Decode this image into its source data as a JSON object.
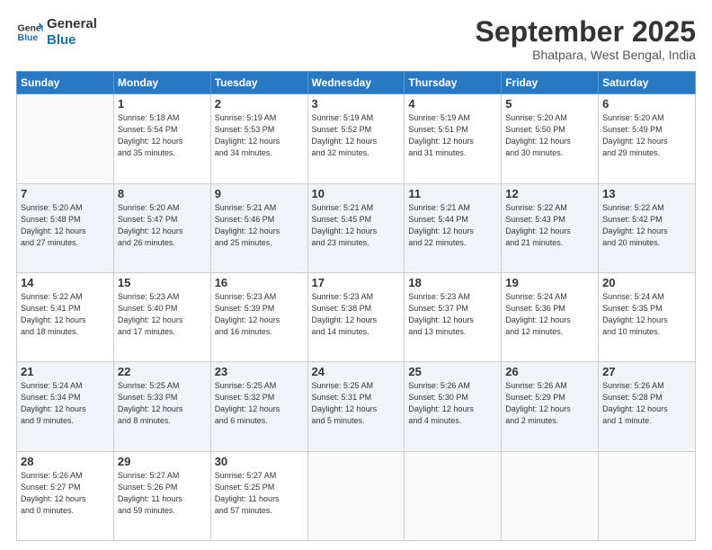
{
  "header": {
    "logo_line1": "General",
    "logo_line2": "Blue",
    "month": "September 2025",
    "location": "Bhatpara, West Bengal, India"
  },
  "days_of_week": [
    "Sunday",
    "Monday",
    "Tuesday",
    "Wednesday",
    "Thursday",
    "Friday",
    "Saturday"
  ],
  "weeks": [
    [
      {
        "day": "",
        "info": ""
      },
      {
        "day": "1",
        "info": "Sunrise: 5:18 AM\nSunset: 5:54 PM\nDaylight: 12 hours\nand 35 minutes."
      },
      {
        "day": "2",
        "info": "Sunrise: 5:19 AM\nSunset: 5:53 PM\nDaylight: 12 hours\nand 34 minutes."
      },
      {
        "day": "3",
        "info": "Sunrise: 5:19 AM\nSunset: 5:52 PM\nDaylight: 12 hours\nand 32 minutes."
      },
      {
        "day": "4",
        "info": "Sunrise: 5:19 AM\nSunset: 5:51 PM\nDaylight: 12 hours\nand 31 minutes."
      },
      {
        "day": "5",
        "info": "Sunrise: 5:20 AM\nSunset: 5:50 PM\nDaylight: 12 hours\nand 30 minutes."
      },
      {
        "day": "6",
        "info": "Sunrise: 5:20 AM\nSunset: 5:49 PM\nDaylight: 12 hours\nand 29 minutes."
      }
    ],
    [
      {
        "day": "7",
        "info": "Sunrise: 5:20 AM\nSunset: 5:48 PM\nDaylight: 12 hours\nand 27 minutes."
      },
      {
        "day": "8",
        "info": "Sunrise: 5:20 AM\nSunset: 5:47 PM\nDaylight: 12 hours\nand 26 minutes."
      },
      {
        "day": "9",
        "info": "Sunrise: 5:21 AM\nSunset: 5:46 PM\nDaylight: 12 hours\nand 25 minutes."
      },
      {
        "day": "10",
        "info": "Sunrise: 5:21 AM\nSunset: 5:45 PM\nDaylight: 12 hours\nand 23 minutes."
      },
      {
        "day": "11",
        "info": "Sunrise: 5:21 AM\nSunset: 5:44 PM\nDaylight: 12 hours\nand 22 minutes."
      },
      {
        "day": "12",
        "info": "Sunrise: 5:22 AM\nSunset: 5:43 PM\nDaylight: 12 hours\nand 21 minutes."
      },
      {
        "day": "13",
        "info": "Sunrise: 5:22 AM\nSunset: 5:42 PM\nDaylight: 12 hours\nand 20 minutes."
      }
    ],
    [
      {
        "day": "14",
        "info": "Sunrise: 5:22 AM\nSunset: 5:41 PM\nDaylight: 12 hours\nand 18 minutes."
      },
      {
        "day": "15",
        "info": "Sunrise: 5:23 AM\nSunset: 5:40 PM\nDaylight: 12 hours\nand 17 minutes."
      },
      {
        "day": "16",
        "info": "Sunrise: 5:23 AM\nSunset: 5:39 PM\nDaylight: 12 hours\nand 16 minutes."
      },
      {
        "day": "17",
        "info": "Sunrise: 5:23 AM\nSunset: 5:38 PM\nDaylight: 12 hours\nand 14 minutes."
      },
      {
        "day": "18",
        "info": "Sunrise: 5:23 AM\nSunset: 5:37 PM\nDaylight: 12 hours\nand 13 minutes."
      },
      {
        "day": "19",
        "info": "Sunrise: 5:24 AM\nSunset: 5:36 PM\nDaylight: 12 hours\nand 12 minutes."
      },
      {
        "day": "20",
        "info": "Sunrise: 5:24 AM\nSunset: 5:35 PM\nDaylight: 12 hours\nand 10 minutes."
      }
    ],
    [
      {
        "day": "21",
        "info": "Sunrise: 5:24 AM\nSunset: 5:34 PM\nDaylight: 12 hours\nand 9 minutes."
      },
      {
        "day": "22",
        "info": "Sunrise: 5:25 AM\nSunset: 5:33 PM\nDaylight: 12 hours\nand 8 minutes."
      },
      {
        "day": "23",
        "info": "Sunrise: 5:25 AM\nSunset: 5:32 PM\nDaylight: 12 hours\nand 6 minutes."
      },
      {
        "day": "24",
        "info": "Sunrise: 5:25 AM\nSunset: 5:31 PM\nDaylight: 12 hours\nand 5 minutes."
      },
      {
        "day": "25",
        "info": "Sunrise: 5:26 AM\nSunset: 5:30 PM\nDaylight: 12 hours\nand 4 minutes."
      },
      {
        "day": "26",
        "info": "Sunrise: 5:26 AM\nSunset: 5:29 PM\nDaylight: 12 hours\nand 2 minutes."
      },
      {
        "day": "27",
        "info": "Sunrise: 5:26 AM\nSunset: 5:28 PM\nDaylight: 12 hours\nand 1 minute."
      }
    ],
    [
      {
        "day": "28",
        "info": "Sunrise: 5:26 AM\nSunset: 5:27 PM\nDaylight: 12 hours\nand 0 minutes."
      },
      {
        "day": "29",
        "info": "Sunrise: 5:27 AM\nSunset: 5:26 PM\nDaylight: 11 hours\nand 59 minutes."
      },
      {
        "day": "30",
        "info": "Sunrise: 5:27 AM\nSunset: 5:25 PM\nDaylight: 11 hours\nand 57 minutes."
      },
      {
        "day": "",
        "info": ""
      },
      {
        "day": "",
        "info": ""
      },
      {
        "day": "",
        "info": ""
      },
      {
        "day": "",
        "info": ""
      }
    ]
  ]
}
